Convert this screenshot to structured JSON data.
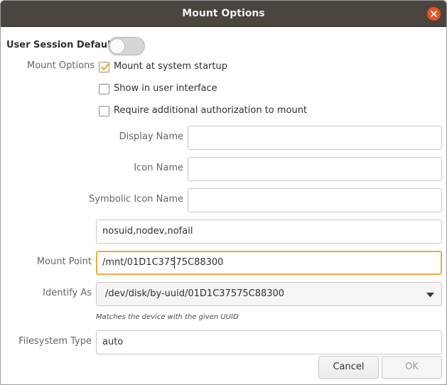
{
  "window": {
    "title": "Mount Options"
  },
  "user_session_defaults": {
    "label": "User Session Defaults",
    "enabled": false
  },
  "mount_options": {
    "section_label": "Mount Options",
    "checkboxes": [
      {
        "label": "Mount at system startup",
        "checked": true
      },
      {
        "label": "Show in user interface",
        "checked": false
      },
      {
        "label": "Require additional authorization to mount",
        "checked": false
      }
    ],
    "display_name": {
      "label": "Display Name",
      "value": ""
    },
    "icon_name": {
      "label": "Icon Name",
      "value": ""
    },
    "symbolic_icon_name": {
      "label": "Symbolic Icon Name",
      "value": ""
    },
    "options_string": {
      "value": "nosuid,nodev,nofail"
    }
  },
  "mount_point": {
    "label": "Mount Point",
    "value": "/mnt/01D1C37575C88300"
  },
  "identify_as": {
    "label": "Identify As",
    "selected": "/dev/disk/by-uuid/01D1C37575C88300",
    "hint": "Matches the device with the given UUID"
  },
  "filesystem_type": {
    "label": "Filesystem Type",
    "value": "auto"
  },
  "buttons": {
    "cancel": "Cancel",
    "ok": "OK"
  },
  "colors": {
    "accent": "#e95420",
    "focus": "#f0ab3c",
    "titlebar": "#4a453f",
    "checkbox_fill": "#f0ab3c"
  },
  "icons": {
    "close": "close-icon",
    "dropdown": "chevron-down-icon",
    "check": "checkmark-icon"
  }
}
